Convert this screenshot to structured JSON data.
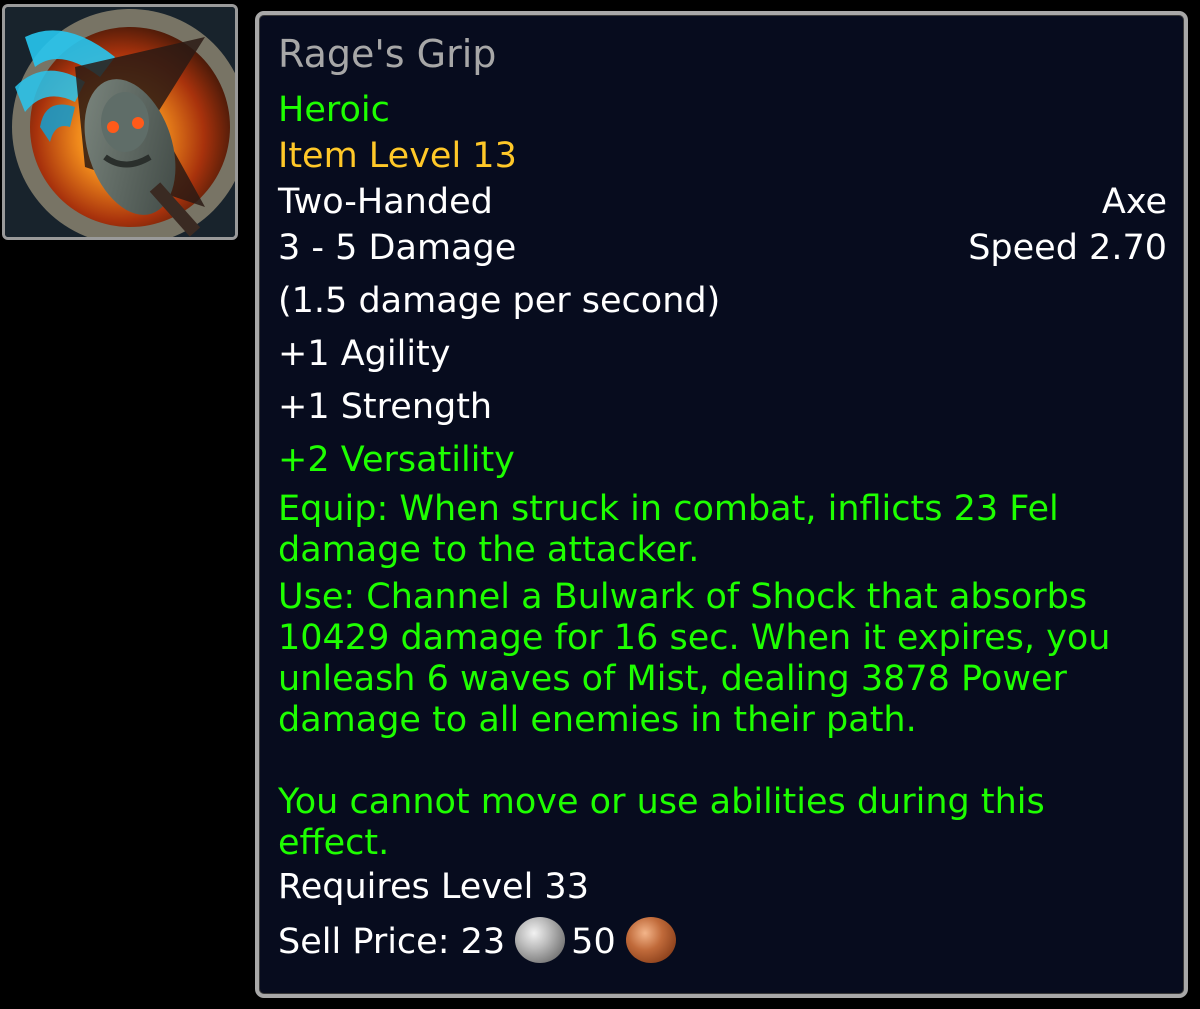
{
  "item": {
    "name": "Rage's Grip",
    "difficulty": "Heroic",
    "item_level": "Item Level 13",
    "slot": "Two-Handed",
    "type": "Axe",
    "damage": "3 - 5 Damage",
    "speed": "Speed 2.70",
    "dps": "(1.5 damage per second)",
    "stats": [
      "+1 Agility",
      "+1 Strength"
    ],
    "bonus_stat": "+2 Versatility",
    "equip_text": "Equip: When struck in combat, inflicts 23 Fel damage to the attacker.",
    "use_text": "Use: Channel a Bulwark of Shock that absorbs 10429 damage for 16 sec. When it expires, you unleash 6 waves of Mist, dealing 3878 Power damage to all enemies in their path.",
    "use_note": "You cannot move or use abilities during this effect.",
    "requirement": "Requires Level 33",
    "sell_label": "Sell Price: 23",
    "sell_copper": "50",
    "icon": "axe-item-icon"
  },
  "colors": {
    "name": "#a7a7a7",
    "heroic_green": "#1eff00",
    "item_level_gold": "#ffc828",
    "background": "#070c1e",
    "border": "#a8a8a8"
  }
}
